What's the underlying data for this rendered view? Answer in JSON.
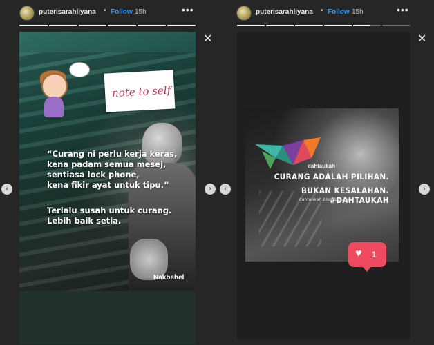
{
  "colors": {
    "background": "#262626",
    "follow": "#3897f0",
    "like": "#ef4b60"
  },
  "stories": [
    {
      "username": "puterisarahliyana",
      "follow_label": "Follow",
      "time": "15h",
      "more_icon": "more-horizontal-icon",
      "close_icon": "close-icon",
      "note_text": "note to self",
      "quote_lines": [
        "“Curang ni perlu kerja keras,",
        "kena padam semua mesej,",
        "sentiasa lock phone,",
        "kena fikir ayat untuk tipu.”"
      ],
      "sub_lines": [
        "Terlalu susah untuk curang.",
        "Lebih baik setia."
      ],
      "signature": "Nakbebel"
    },
    {
      "username": "puterisarahliyana",
      "follow_label": "Follow",
      "time": "15h",
      "more_icon": "more-horizontal-icon",
      "close_icon": "close-icon",
      "brand": "dahtaukah",
      "headline_1": "CURANG ADALAH PILIHAN.",
      "headline_2": "BUKAN KESALAHAN. #DAHTAUKAH",
      "blog": "dahtaukah.blogspot.com",
      "like_count": "1"
    }
  ],
  "nav": {
    "prev_icon": "chevron-left-icon",
    "next_icon": "chevron-right-icon"
  }
}
